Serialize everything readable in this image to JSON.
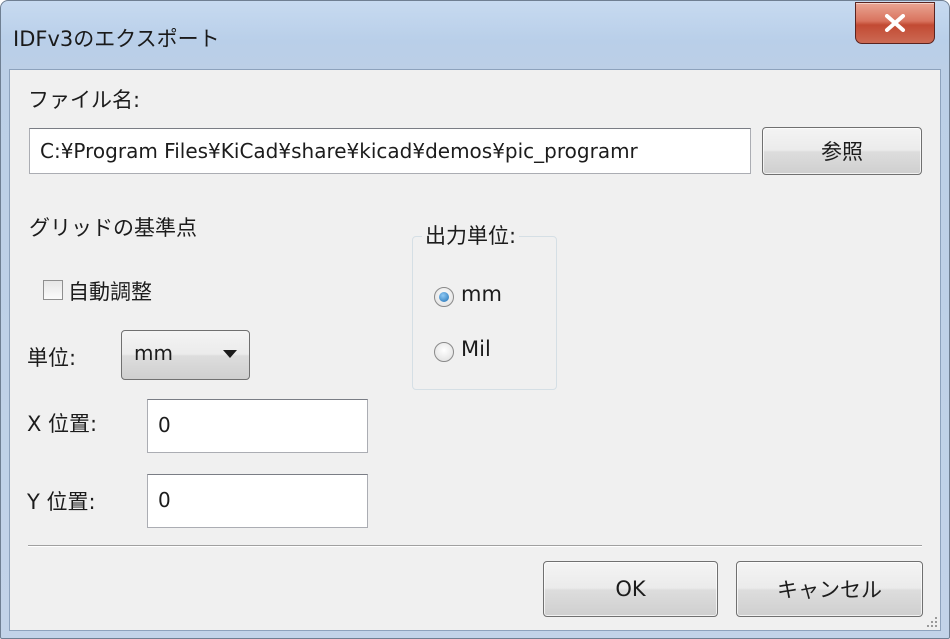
{
  "window": {
    "title": "IDFv3のエクスポート",
    "close_label": "X"
  },
  "file": {
    "label": "ファイル名:",
    "path": "C:¥Program Files¥KiCad¥share¥kicad¥demos¥pic_programr",
    "browse_label": "参照"
  },
  "grid_origin": {
    "heading": "グリッドの基準点",
    "auto_adjust_label": "自動調整",
    "auto_adjust_checked": false,
    "unit_label": "単位:",
    "unit_value": "mm",
    "x_label": "X 位置:",
    "x_value": "0",
    "y_label": "Y 位置:",
    "y_value": "0"
  },
  "output_units": {
    "legend": "出力単位:",
    "options": [
      {
        "label": "mm",
        "selected": true
      },
      {
        "label": "Mil",
        "selected": false
      }
    ]
  },
  "footer": {
    "ok_label": "OK",
    "cancel_label": "キャンセル"
  },
  "icons": {
    "close": "close-x-icon",
    "dropdown": "chevron-down-icon",
    "resize": "resize-grip-icon"
  },
  "colors": {
    "close_button": "#c9503a",
    "radio_dot": "#1f6fb3"
  }
}
